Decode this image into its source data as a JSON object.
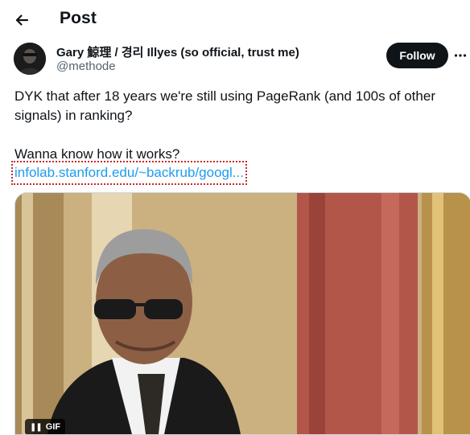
{
  "header": {
    "title": "Post",
    "back_icon": "arrow-left-icon"
  },
  "author": {
    "display_name": "Gary 鯨理 / 경리 Illyes (so official, trust me)",
    "handle": "@methode"
  },
  "actions": {
    "follow_label": "Follow",
    "more_icon": "more-horizontal-icon"
  },
  "tweet": {
    "lines": [
      "DYK that after 18 years we're still using PageRank (and 100s of other",
      "signals) in ranking?",
      "",
      "Wanna know how it works?"
    ],
    "link_text": "infolab.stanford.edu/~backrub/googl..."
  },
  "media": {
    "type_badge": "GIF",
    "badge_icon": "pause-icon"
  },
  "colors": {
    "text": "#0f1419",
    "muted": "#536471",
    "link": "#1d9bf0",
    "button": "#0f1419"
  }
}
